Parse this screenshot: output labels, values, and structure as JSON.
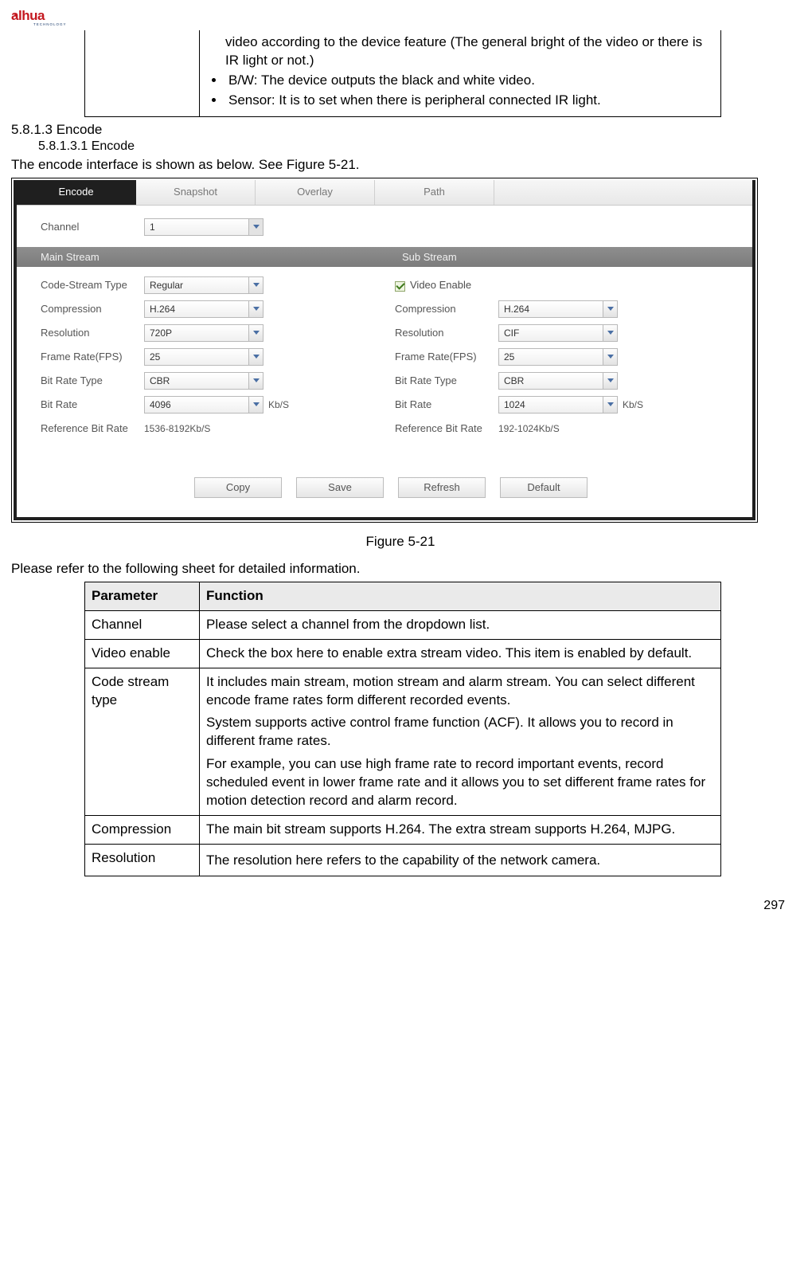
{
  "logo_text": "alhua",
  "logo_sub": "TECHNOLOGY",
  "frag_bullets_pre": "video according to the device feature (The general bright of the video or there is IR light or not.)",
  "frag_bullets": [
    "B/W: The device outputs the black and white video.",
    "Sensor: It is to set when there is peripheral connected IR light."
  ],
  "sec1": "5.8.1.3 Encode",
  "sec2": "5.8.1.3.1 Encode",
  "intro": "The encode interface is shown as below. See Figure 5-21.",
  "figure": {
    "tabs": [
      "Encode",
      "Snapshot",
      "Overlay",
      "Path"
    ],
    "channel_label": "Channel",
    "channel_value": "1",
    "main_header": "Main Stream",
    "sub_header": "Sub Stream",
    "video_enable_label": "Video Enable",
    "rows": [
      {
        "label": "Code-Stream Type",
        "main": "Regular",
        "sub_label": "Compression",
        "sub": "H.264"
      },
      {
        "label": "Compression",
        "main": "H.264",
        "sub_label": "Resolution",
        "sub": "CIF"
      },
      {
        "label": "Resolution",
        "main": "720P",
        "sub_label": "Frame Rate(FPS)",
        "sub": "25"
      },
      {
        "label": "Frame Rate(FPS)",
        "main": "25",
        "sub_label": "Bit Rate Type",
        "sub": "CBR"
      },
      {
        "label": "Bit Rate Type",
        "main": "CBR",
        "sub_label": "Bit Rate",
        "sub": "1024",
        "sub_unit": "Kb/S"
      },
      {
        "label": "Bit Rate",
        "main": "4096",
        "main_unit": "Kb/S",
        "sub_label": "Reference Bit Rate",
        "sub_text": "192-1024Kb/S"
      },
      {
        "label": "Reference Bit Rate",
        "main_text": "1536-8192Kb/S"
      }
    ],
    "buttons": [
      "Copy",
      "Save",
      "Refresh",
      "Default"
    ]
  },
  "fig_caption": "Figure 5-21",
  "table_intro": "Please refer to the following sheet for detailed information.",
  "param_head": {
    "p": "Parameter",
    "f": "Function"
  },
  "params": [
    {
      "p": "Channel",
      "f": "Please select a channel from the dropdown list."
    },
    {
      "p": "Video enable",
      "f": "Check the box here to enable extra stream video. This item is enabled by default."
    },
    {
      "p": "Code stream type",
      "f": [
        "It includes main stream, motion stream and alarm stream. You can select different encode frame rates form different recorded events.",
        "System supports active control frame function (ACF). It allows you to record in different frame rates.",
        "For example, you can use high frame rate to record important events, record scheduled event in lower frame rate and it allows you to set different frame rates for motion detection record and alarm record."
      ]
    },
    {
      "p": "Compression",
      "f": "The main bit stream supports H.264. The extra stream supports H.264, MJPG."
    },
    {
      "p": "Resolution",
      "f": "The resolution here refers to the capability of the network camera.",
      "justify": true
    }
  ],
  "page_num": "297"
}
